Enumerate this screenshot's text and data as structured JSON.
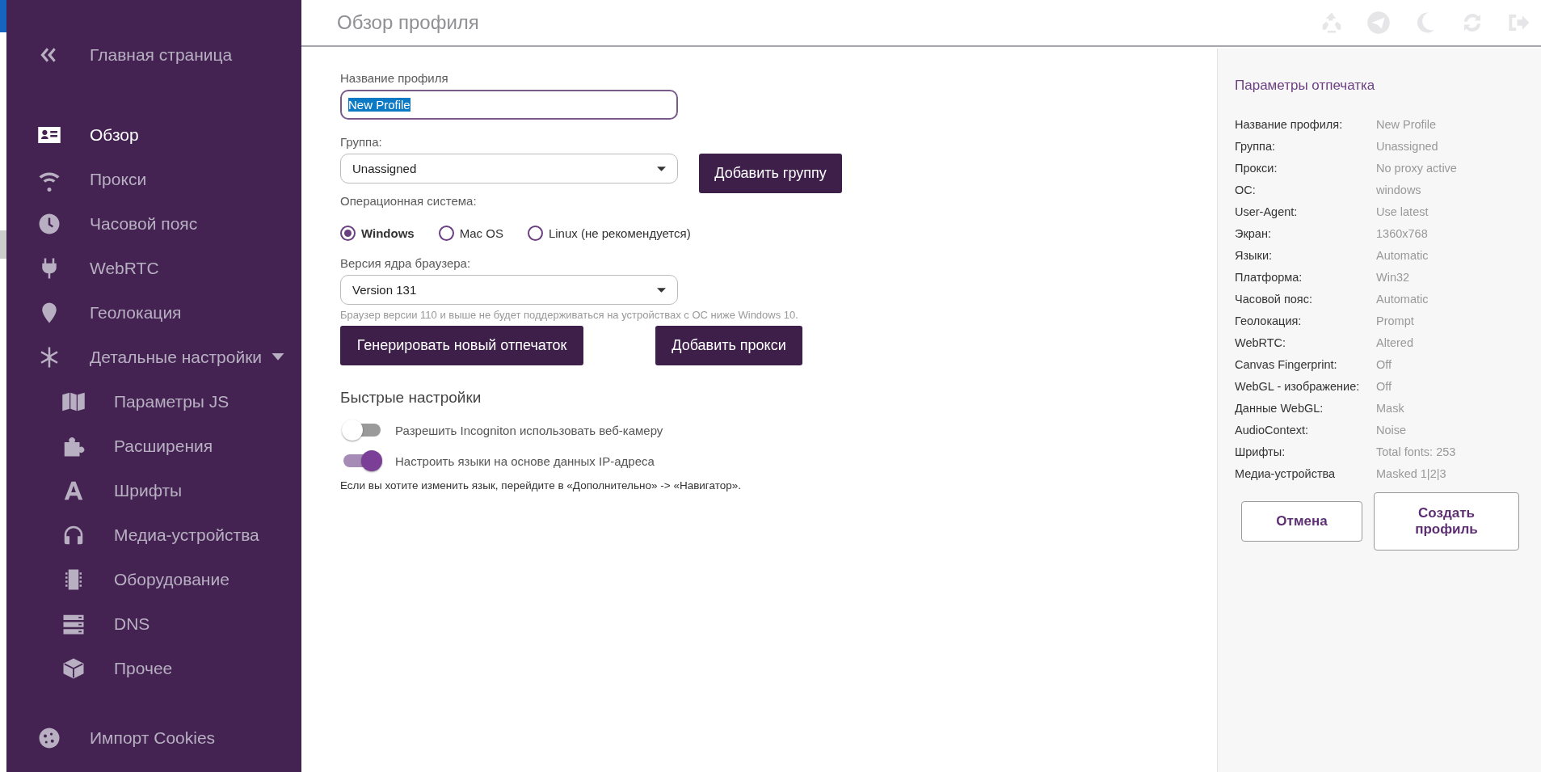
{
  "sidebar": {
    "items": [
      {
        "kind": "back",
        "label": "Главная страница",
        "selected": false
      },
      {
        "kind": "overview",
        "label": "Обзор",
        "selected": true
      },
      {
        "kind": "proxy",
        "label": "Прокси",
        "selected": false
      },
      {
        "kind": "timezone",
        "label": "Часовой пояс",
        "selected": false
      },
      {
        "kind": "webrtc",
        "label": "WebRTC",
        "selected": false
      },
      {
        "kind": "geo",
        "label": "Геолокация",
        "selected": false
      },
      {
        "kind": "advanced",
        "label": "Детальные настройки",
        "selected": false,
        "expanded": true,
        "children": [
          {
            "kind": "js",
            "label": "Параметры JS",
            "selected": false
          },
          {
            "kind": "extensions",
            "label": "Расширения",
            "selected": false
          },
          {
            "kind": "fonts",
            "label": "Шрифты",
            "selected": false
          },
          {
            "kind": "media",
            "label": "Медиа-устройства",
            "selected": false
          },
          {
            "kind": "hardware",
            "label": "Оборудование",
            "selected": false
          },
          {
            "kind": "dns",
            "label": "DNS",
            "selected": false
          },
          {
            "kind": "other",
            "label": "Прочее",
            "selected": false
          }
        ]
      },
      {
        "kind": "cookies",
        "label": "Импорт Cookies",
        "selected": false
      }
    ]
  },
  "header": {
    "title": "Обзор профиля"
  },
  "form": {
    "profile_name": {
      "label": "Название профиля",
      "value": "New Profile",
      "text_selected": true
    },
    "group": {
      "label": "Группа:",
      "value": "Unassigned",
      "button": "Добавить группу"
    },
    "os": {
      "label": "Операционная система:",
      "options": [
        {
          "label": "Windows",
          "selected": true
        },
        {
          "label": "Mac OS",
          "selected": false
        },
        {
          "label": "Linux (не рекомендуется)",
          "selected": false
        }
      ]
    },
    "browser_version": {
      "label": "Версия ядра браузера:",
      "value": "Version 131",
      "hint": "Браузер версии 110 и выше не будет поддерживаться на устройствах с ОС ниже Windows 10."
    },
    "buttons": [
      "Генерировать новый отпечаток",
      "Добавить прокси"
    ],
    "quick_settings": {
      "title": "Быстрые настройки",
      "toggles": [
        {
          "label": "Разрешить Incogniton использовать веб-камеру",
          "on": false
        },
        {
          "label": "Настроить языки на основе данных IP-адреса",
          "on": true
        }
      ],
      "note": "Если вы хотите изменить язык, перейдите в «Дополнительно» -> «Навигатор»."
    }
  },
  "summary": {
    "title": "Параметры отпечатка",
    "rows": [
      {
        "label": "Название профиля:",
        "value": "New Profile"
      },
      {
        "label": "Группа:",
        "value": "Unassigned"
      },
      {
        "label": "Прокси:",
        "value": "No proxy active"
      },
      {
        "label": "ОС:",
        "value": "windows"
      },
      {
        "label": "User-Agent:",
        "value": "Use latest"
      },
      {
        "label": "Экран:",
        "value": "1360x768"
      },
      {
        "label": "Языки:",
        "value": "Automatic"
      },
      {
        "label": "Платформа:",
        "value": "Win32"
      },
      {
        "label": "Часовой пояс:",
        "value": "Automatic"
      },
      {
        "label": "Геолокация:",
        "value": "Prompt"
      },
      {
        "label": "WebRTC:",
        "value": "Altered"
      },
      {
        "label": "Canvas Fingerprint:",
        "value": "Off"
      },
      {
        "label": "WebGL - изображение:",
        "value": "Off"
      },
      {
        "label": "Данные WebGL:",
        "value": "Mask"
      },
      {
        "label": "AudioContext:",
        "value": "Noise"
      },
      {
        "label": "Шрифты:",
        "value": "Total fonts: 253"
      },
      {
        "label": "Медиа-устройства",
        "value": "Masked 1|2|3"
      }
    ],
    "cancel": "Отмена",
    "create": "Создать профиль"
  }
}
